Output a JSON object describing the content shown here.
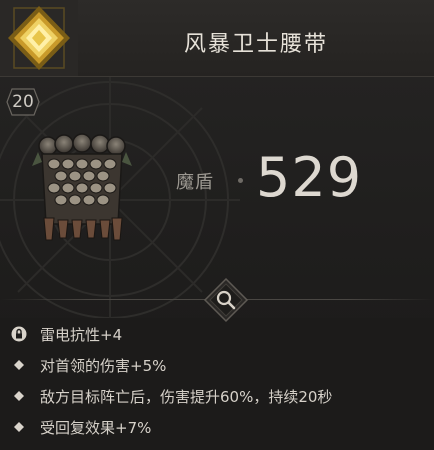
{
  "item": {
    "name": "风暴卫士腰带",
    "level": "20",
    "rarity_color": "#e8c54a",
    "stat": {
      "label": "魔盾",
      "value": "529"
    }
  },
  "affixes": [
    {
      "icon": "lock-icon",
      "text": "雷电抗性+4"
    },
    {
      "icon": "diamond-bullet-icon",
      "text": "对首领的伤害+5%"
    },
    {
      "icon": "diamond-bullet-icon",
      "text": "敌方目标阵亡后，伤害提升60%，持续20秒"
    },
    {
      "icon": "diamond-bullet-icon",
      "text": "受回复效果+7%"
    }
  ]
}
